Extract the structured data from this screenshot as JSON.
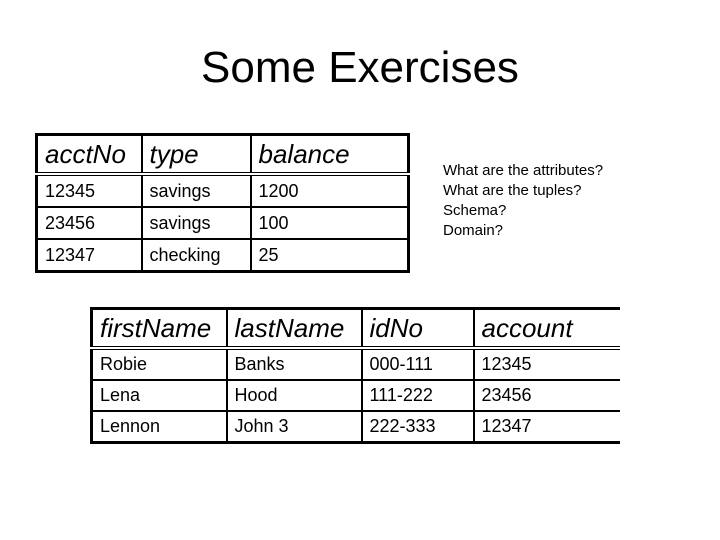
{
  "title": "Some Exercises",
  "accounts_table": {
    "headers": [
      "acctNo",
      "type",
      "balance"
    ],
    "rows": [
      [
        "12345",
        "savings",
        "1200"
      ],
      [
        "23456",
        "savings",
        "100"
      ],
      [
        "12347",
        "checking",
        "25"
      ]
    ]
  },
  "questions": [
    "What are the attributes?",
    "What are the tuples?",
    "Schema?",
    "Domain?"
  ],
  "customers_table": {
    "headers": [
      "firstName",
      "lastName",
      "idNo",
      "account"
    ],
    "rows": [
      [
        "Robie",
        "Banks",
        "000-111",
        "12345"
      ],
      [
        "Lena",
        "Hood",
        "111-222",
        "23456"
      ],
      [
        "Lennon",
        "John 3",
        "222-333",
        "12347"
      ]
    ]
  }
}
